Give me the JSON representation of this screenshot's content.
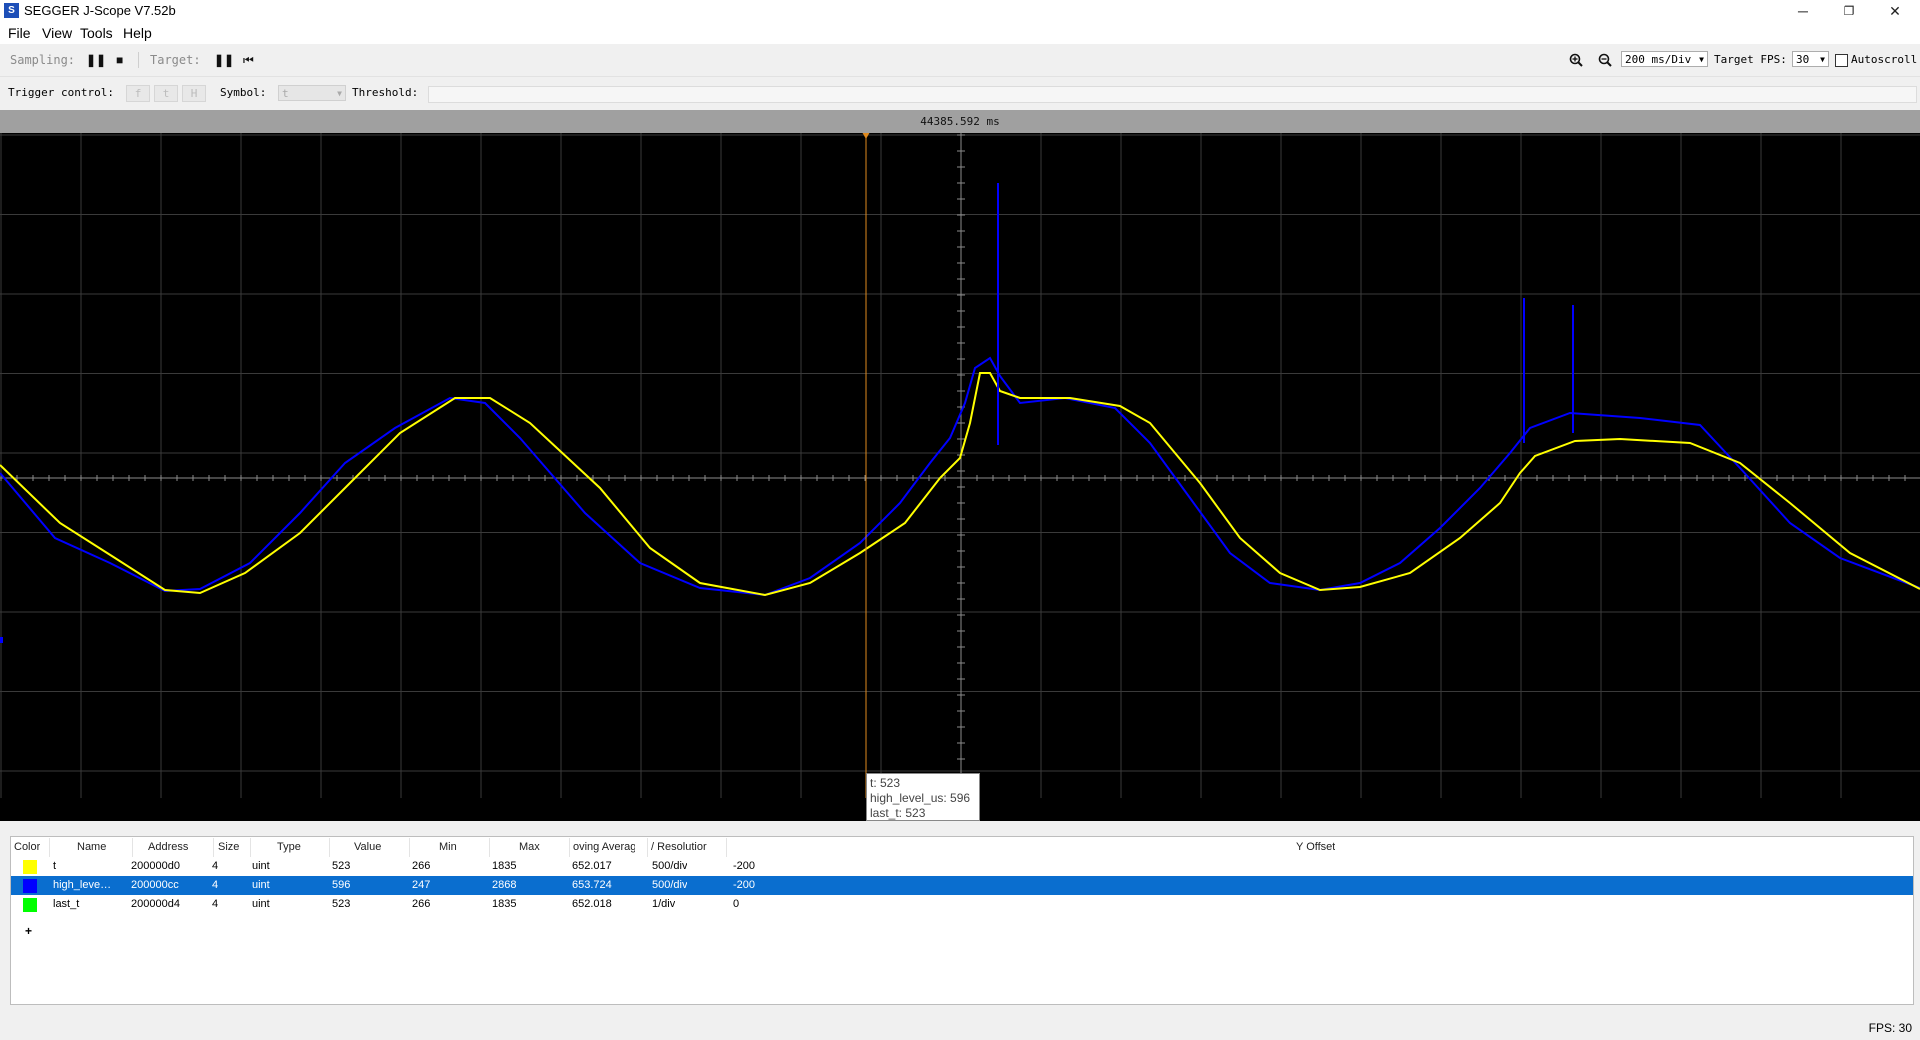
{
  "window": {
    "title": "SEGGER J-Scope V7.52b",
    "app_icon": "segger-icon",
    "minimize": "─",
    "restore": "❐",
    "close": "✕"
  },
  "menu": {
    "items": [
      "File",
      "View",
      "Tools",
      "Help"
    ]
  },
  "toolbar": {
    "sampling_label": "Sampling:",
    "target_label": "Target:",
    "time_per_div": "200 ms/Div",
    "target_fps_label": "Target FPS:",
    "target_fps": "30",
    "autoscroll_label": "Autoscroll",
    "autoscroll_checked": false
  },
  "trigger": {
    "label": "Trigger control:",
    "rising": "f",
    "falling": "t",
    "both": "H",
    "symbol_label": "Symbol:",
    "symbol_value": "t",
    "threshold_label": "Threshold:",
    "threshold_value": ""
  },
  "scope": {
    "time_readout": "44385.592 ms",
    "background": "#000000",
    "grid_color": "#3a3a3a",
    "cursor_color": "#e08a1e",
    "tooltip": {
      "line1": "t: 523",
      "line2": "high_level_us: 596",
      "line3": "last_t: 523"
    }
  },
  "table": {
    "headers": [
      "Color",
      "Name",
      "Address",
      "Size",
      "Type",
      "Value",
      "Min",
      "Max",
      "oving Averag",
      "/ Resolutior",
      "Y Offset"
    ],
    "rows": [
      {
        "color": "#ffff00",
        "name": "t",
        "address": "200000d0",
        "size": "4",
        "type": "uint",
        "value": "523",
        "min": "266",
        "max": "1835",
        "avg": "652.017",
        "res": "500/div",
        "offset": "-200",
        "selected": false
      },
      {
        "color": "#0000ff",
        "name": "high_leve…",
        "address": "200000cc",
        "size": "4",
        "type": "uint",
        "value": "596",
        "min": "247",
        "max": "2868",
        "avg": "653.724",
        "res": "500/div",
        "offset": "-200",
        "selected": true
      },
      {
        "color": "#00ff00",
        "name": "last_t",
        "address": "200000d4",
        "size": "4",
        "type": "uint",
        "value": "523",
        "min": "266",
        "max": "1835",
        "avg": "652.018",
        "res": "1/div",
        "offset": "0",
        "selected": false
      }
    ],
    "add_label": "+"
  },
  "status": {
    "fps": "FPS: 30"
  },
  "chart_data": {
    "type": "line",
    "series": [
      {
        "name": "t",
        "color": "#ffff00"
      },
      {
        "name": "high_level_us",
        "color": "#0000ff"
      },
      {
        "name": "last_t",
        "color": "#00ff00"
      }
    ],
    "time_per_div": "200 ms/Div",
    "grid": true
  }
}
